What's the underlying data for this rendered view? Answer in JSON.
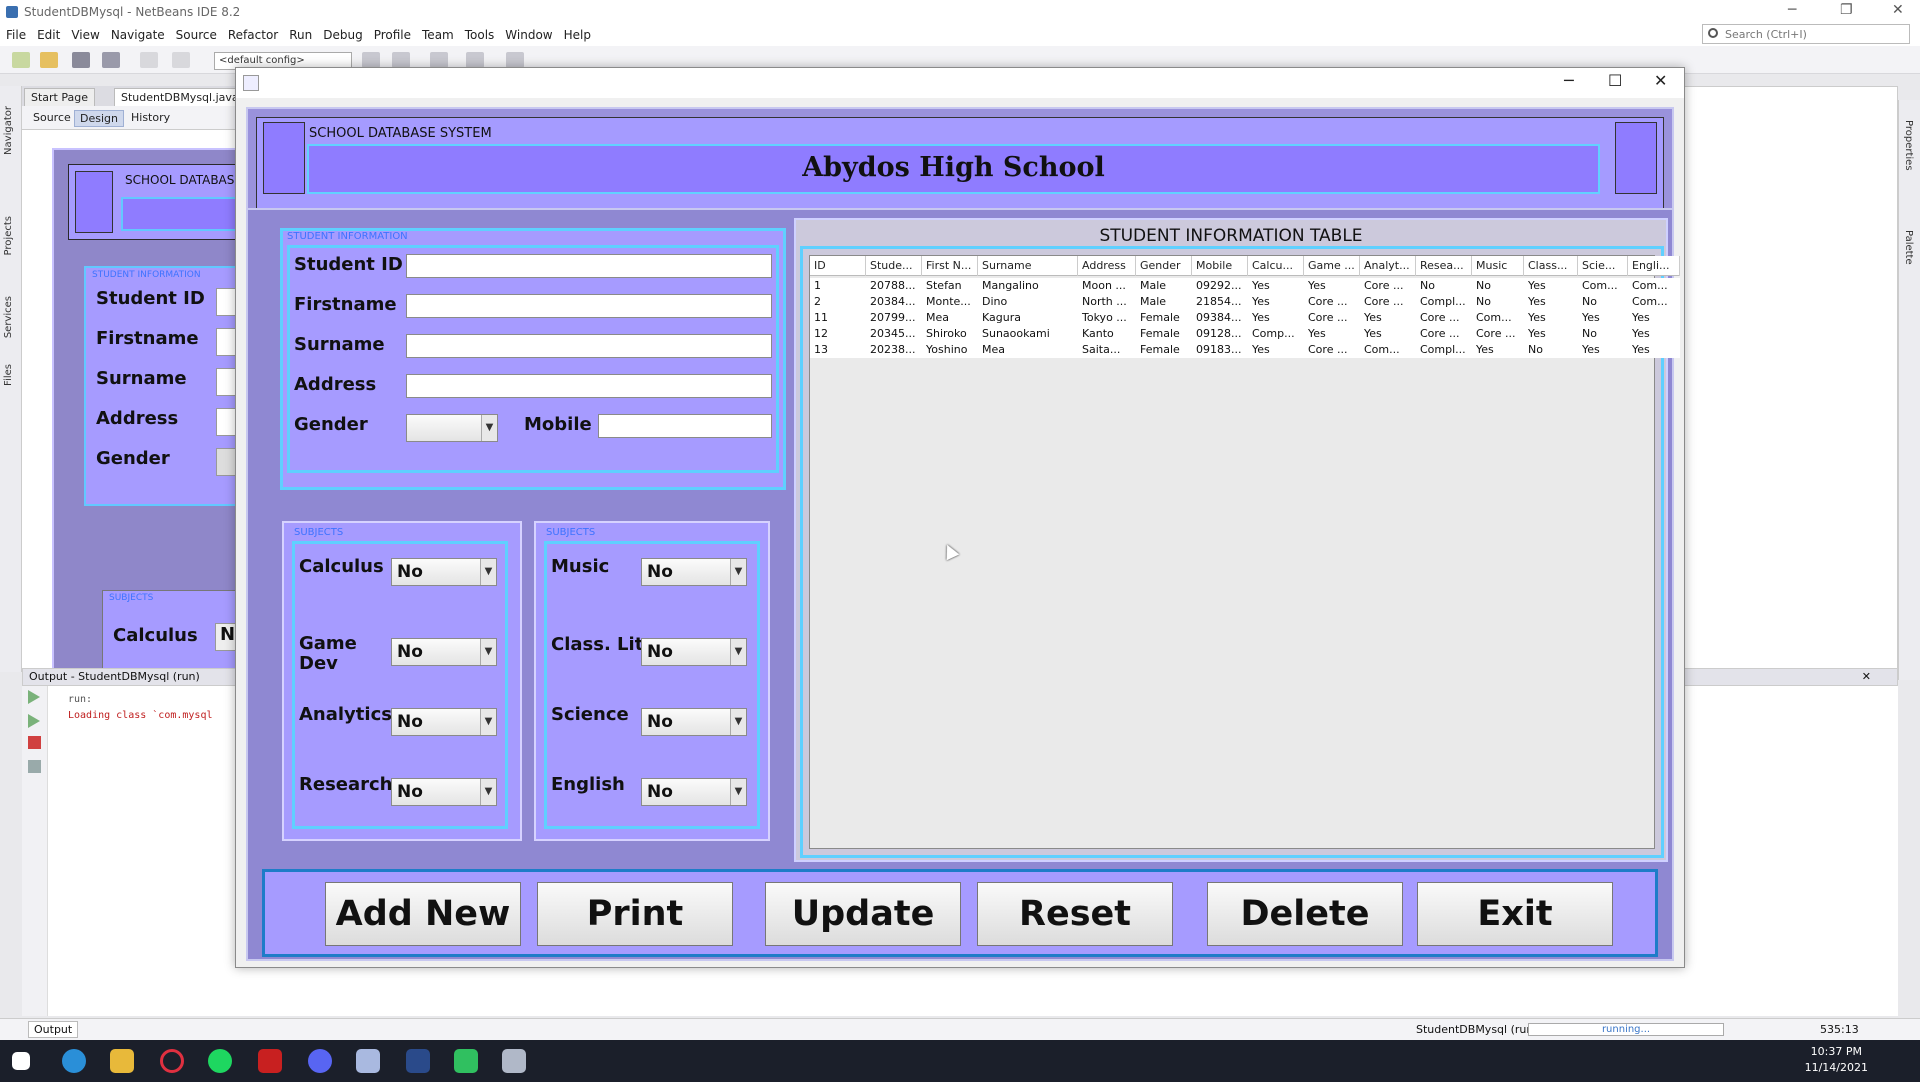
{
  "ide": {
    "title": "StudentDBMysql - NetBeans IDE 8.2",
    "menu": [
      "File",
      "Edit",
      "View",
      "Navigate",
      "Source",
      "Refactor",
      "Run",
      "Debug",
      "Profile",
      "Team",
      "Tools",
      "Window",
      "Help"
    ],
    "search_placeholder": "Search (Ctrl+I)",
    "config": "<default config>",
    "tabs": [
      "Start Page",
      "StudentDBMysql.java"
    ],
    "subtabs": [
      "Source",
      "Design",
      "History"
    ],
    "left_labels": [
      "Navigator",
      "Projects",
      "Services",
      "Files"
    ],
    "right_labels": [
      "Properties",
      "Palette"
    ],
    "output_title": "Output - StudentDBMysql (run)",
    "output_lines": [
      "run:",
      "Loading class `com.mysql"
    ],
    "output_tab": "Output",
    "status_project": "StudentDBMysql (run)",
    "status_progress": "running...",
    "status_pos": "535:13",
    "design_preview": {
      "header_label": "SCHOOL DATABAS",
      "info_caption": "STUDENT INFORMATION",
      "fields": [
        "Student ID",
        "Firstname",
        "Surname",
        "Address",
        "Gender"
      ],
      "subjects_caption": "SUBJECTS",
      "subject_label": "Calculus",
      "subject_value": "No"
    }
  },
  "taskbar": {
    "time": "10:37 PM",
    "date": "11/14/2021"
  },
  "app": {
    "system_label": "SCHOOL DATABASE SYSTEM",
    "school_name": "Abydos High School",
    "info": {
      "caption": "STUDENT INFORMATION",
      "student_id_label": "Student ID",
      "firstname_label": "Firstname",
      "surname_label": "Surname",
      "address_label": "Address",
      "gender_label": "Gender",
      "mobile_label": "Mobile",
      "student_id": "",
      "firstname": "",
      "surname": "",
      "address": "",
      "gender": "",
      "mobile": ""
    },
    "subjects_left": {
      "caption": "SUBJECTS",
      "items": [
        {
          "label": "Calculus",
          "value": "No"
        },
        {
          "label": "Game Dev",
          "value": "No"
        },
        {
          "label": "Analytics",
          "value": "No"
        },
        {
          "label": "Research",
          "value": "No"
        }
      ]
    },
    "subjects_right": {
      "caption": "SUBJECTS",
      "items": [
        {
          "label": "Music",
          "value": "No"
        },
        {
          "label": "Class. Lit.",
          "value": "No"
        },
        {
          "label": "Science",
          "value": "No"
        },
        {
          "label": "English",
          "value": "No"
        }
      ]
    },
    "table": {
      "title": "STUDENT INFORMATION TABLE",
      "columns": [
        "ID",
        "Stude...",
        "First N...",
        "Surname",
        "Address",
        "Gender",
        "Mobile",
        "Calcu...",
        "Game ...",
        "Analyt...",
        "Resea...",
        "Music",
        "Class...",
        "Scie...",
        "Engli..."
      ],
      "rows": [
        [
          "1",
          "20788...",
          "Stefan",
          "Mangalino",
          "Moon ...",
          "Male",
          "09292...",
          "Yes",
          "Yes",
          "Core ...",
          "No",
          "No",
          "Yes",
          "Com...",
          "Com..."
        ],
        [
          "2",
          "20384...",
          "Monte...",
          "Dino",
          "North ...",
          "Male",
          "21854...",
          "Yes",
          "Core ...",
          "Core ...",
          "Compl...",
          "No",
          "Yes",
          "No",
          "Com..."
        ],
        [
          "11",
          "20799...",
          "Mea",
          "Kagura",
          "Tokyo ...",
          "Female",
          "09384...",
          "Yes",
          "Core ...",
          "Yes",
          "Core ...",
          "Com...",
          "Yes",
          "Yes",
          "Yes"
        ],
        [
          "12",
          "20345...",
          "Shiroko",
          "Sunaookami",
          "Kanto",
          "Female",
          "09128...",
          "Comp...",
          "Yes",
          "Yes",
          "Core ...",
          "Core ...",
          "Yes",
          "No",
          "Yes"
        ],
        [
          "13",
          "20238...",
          "Yoshino",
          "Mea",
          "Saita...",
          "Female",
          "09183...",
          "Yes",
          "Core ...",
          "Com...",
          "Compl...",
          "Yes",
          "No",
          "Yes",
          "Yes"
        ]
      ]
    },
    "buttons": [
      "Add New",
      "Print",
      "Update",
      "Reset",
      "Delete",
      "Exit"
    ]
  }
}
